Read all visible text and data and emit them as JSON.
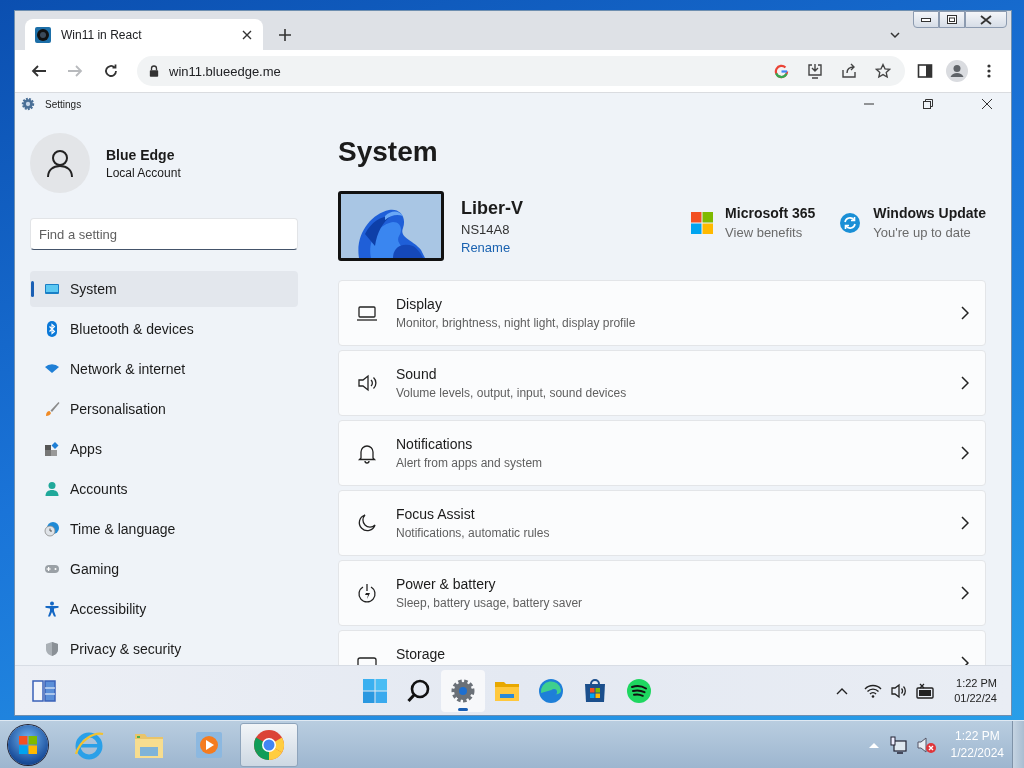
{
  "browser": {
    "tabs": [
      {
        "title": "Win11 in React",
        "selected": true
      }
    ],
    "nav_buttons": [
      {
        "kind": "back",
        "disabled": false
      },
      {
        "kind": "forward",
        "disabled": true
      },
      {
        "kind": "reload",
        "disabled": false
      }
    ],
    "address": "win11.blueedge.me"
  },
  "settings": {
    "title": "Settings",
    "profile": {
      "name": "Blue Edge",
      "account_type": "Local Account"
    },
    "search": {
      "placeholder": "Find a setting"
    },
    "nav": [
      {
        "kind": "system",
        "label": "System",
        "selected": true
      },
      {
        "kind": "bluetooth",
        "label": "Bluetooth & devices",
        "selected": false
      },
      {
        "kind": "network",
        "label": "Network & internet",
        "selected": false
      },
      {
        "kind": "personalisation",
        "label": "Personalisation",
        "selected": false
      },
      {
        "kind": "apps",
        "label": "Apps",
        "selected": false
      },
      {
        "kind": "accounts",
        "label": "Accounts",
        "selected": false
      },
      {
        "kind": "time",
        "label": "Time & language",
        "selected": false
      },
      {
        "kind": "gaming",
        "label": "Gaming",
        "selected": false
      },
      {
        "kind": "accessibility",
        "label": "Accessibility",
        "selected": false
      },
      {
        "kind": "privacy",
        "label": "Privacy & security",
        "selected": false
      }
    ],
    "page_title": "System",
    "device": {
      "name": "Liber-V",
      "model": "NS14A8",
      "rename": "Rename"
    },
    "promos": [
      {
        "kind": "m365",
        "title": "Microsoft 365",
        "subtitle": "View benefits"
      },
      {
        "kind": "update",
        "title": "Windows Update",
        "subtitle": "You're up to date"
      }
    ],
    "cards": [
      {
        "kind": "display",
        "title": "Display",
        "subtitle": "Monitor, brightness, night light, display profile"
      },
      {
        "kind": "sound",
        "title": "Sound",
        "subtitle": "Volume levels, output, input, sound devices"
      },
      {
        "kind": "notifications",
        "title": "Notifications",
        "subtitle": "Alert from apps and system"
      },
      {
        "kind": "focus",
        "title": "Focus Assist",
        "subtitle": "Notifications, automatic rules"
      },
      {
        "kind": "power",
        "title": "Power & battery",
        "subtitle": "Sleep, battery usage, battery saver"
      },
      {
        "kind": "storage",
        "title": "Storage"
      }
    ]
  },
  "win11_taskbar": {
    "apps": [
      {
        "kind": "start",
        "selected": false
      },
      {
        "kind": "search",
        "selected": false
      },
      {
        "kind": "settings",
        "selected": true
      },
      {
        "kind": "files",
        "selected": false
      },
      {
        "kind": "edge",
        "selected": false
      },
      {
        "kind": "store",
        "selected": false
      },
      {
        "kind": "music",
        "selected": false
      }
    ],
    "time": "1:22 PM",
    "date": "01/22/24"
  },
  "win7_taskbar": {
    "apps": [
      {
        "kind": "ie",
        "selected": false
      },
      {
        "kind": "explorer",
        "selected": false
      },
      {
        "kind": "media",
        "selected": false
      },
      {
        "kind": "chrome",
        "selected": true
      }
    ],
    "time": "1:22 PM",
    "date": "1/22/2024"
  }
}
